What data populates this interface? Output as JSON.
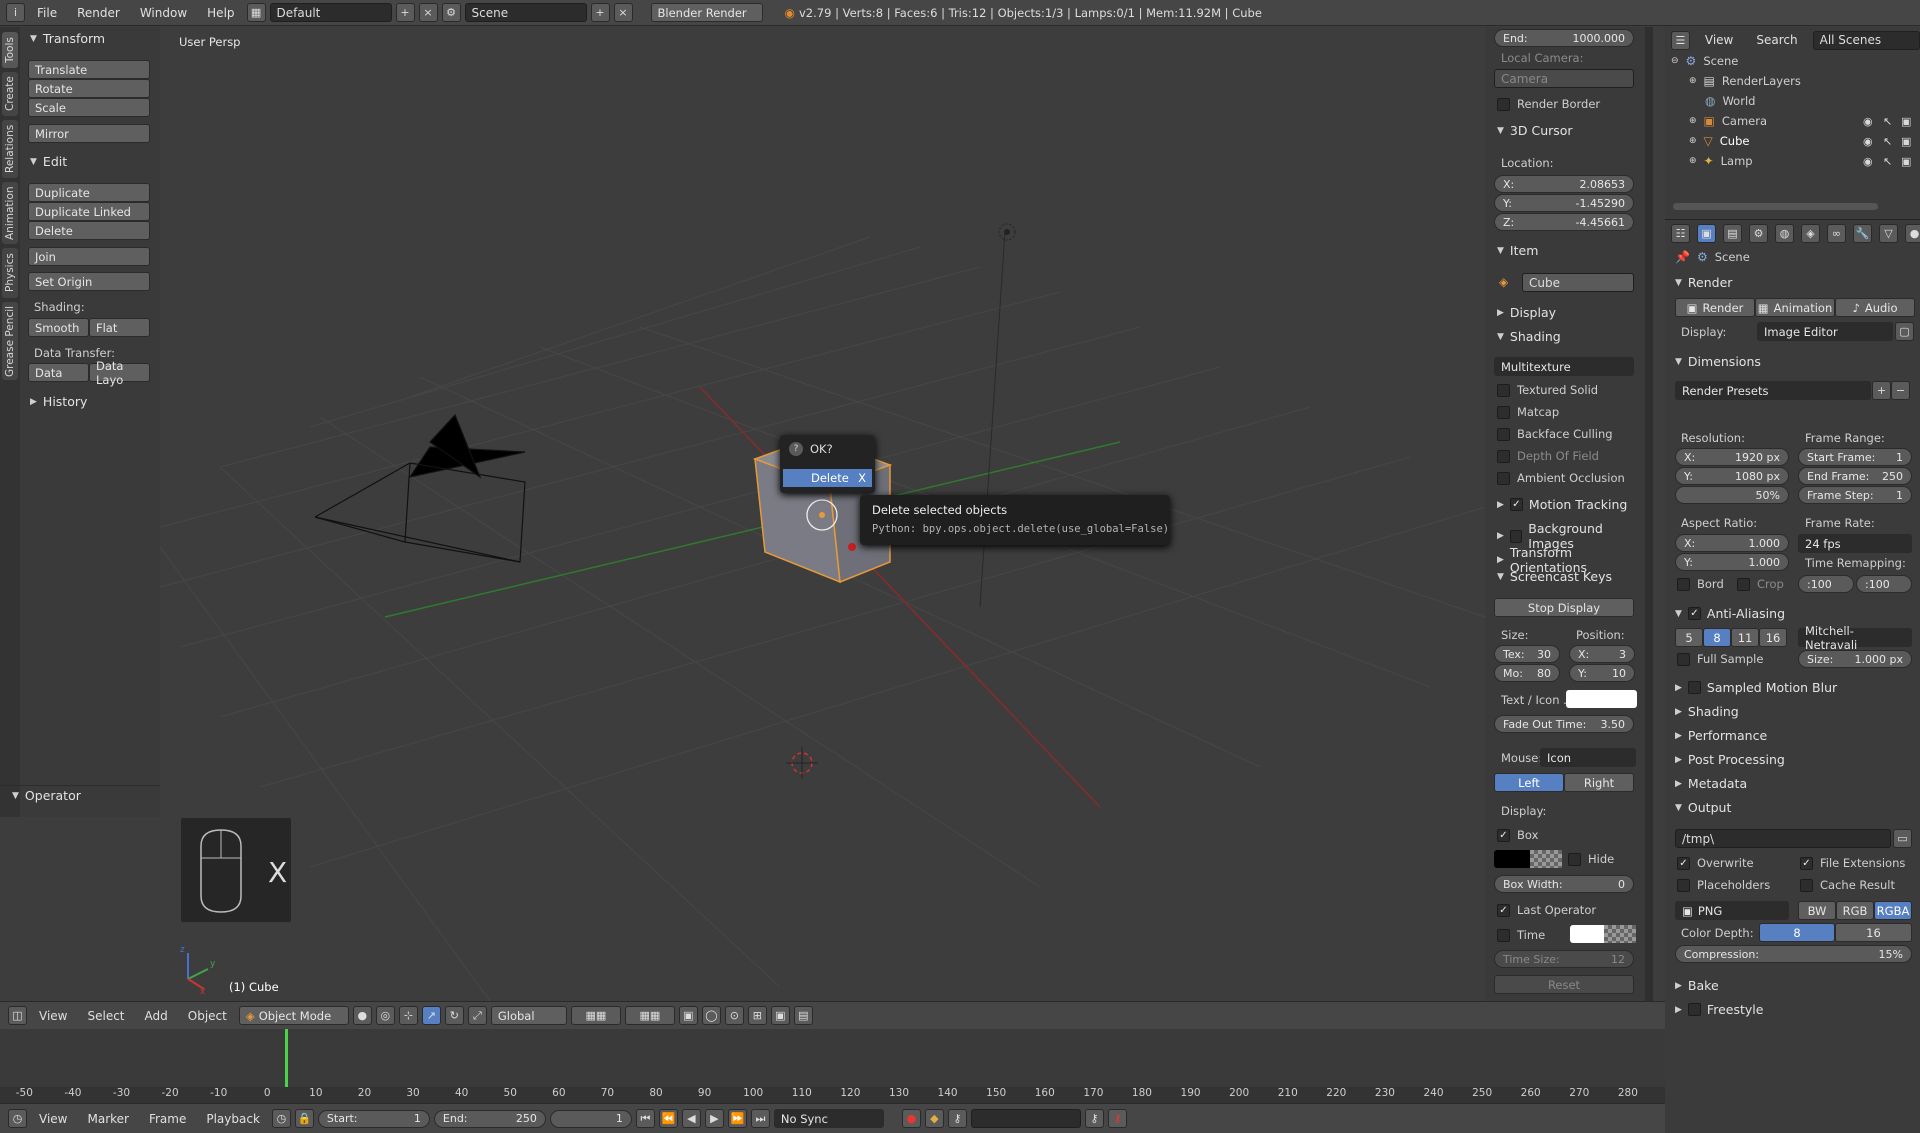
{
  "topbar": {
    "menus": [
      "File",
      "Render",
      "Window",
      "Help"
    ],
    "layout": "Default",
    "scene": "Scene",
    "engine": "Blender Render",
    "stats": "v2.79 | Verts:8 | Faces:6 | Tris:12 | Objects:1/3 | Lamps:0/1 | Mem:11.92M | Cube"
  },
  "tabs": [
    "Tools",
    "Create",
    "Relations",
    "Animation",
    "Physics",
    "Grease Pencil"
  ],
  "toolshelf": {
    "transform_title": "Transform",
    "translate": "Translate",
    "rotate": "Rotate",
    "scale": "Scale",
    "mirror": "Mirror",
    "edit_title": "Edit",
    "duplicate": "Duplicate",
    "duplicate_linked": "Duplicate Linked",
    "delete": "Delete",
    "join": "Join",
    "set_origin": "Set Origin",
    "shading_label": "Shading:",
    "smooth": "Smooth",
    "flat": "Flat",
    "data_transfer_label": "Data Transfer:",
    "data": "Data",
    "data_layo": "Data Layo",
    "history": "History",
    "operator": "Operator"
  },
  "viewport": {
    "label": "User Persp",
    "object_label": "(1) Cube",
    "key_x": "X",
    "axis_x": "x",
    "axis_y": "y",
    "axis_z": "z"
  },
  "popup": {
    "title": "OK?",
    "delete": "Delete",
    "shortcut": "X"
  },
  "tooltip": {
    "title": "Delete selected objects",
    "python": "Python: bpy.ops.object.delete(use_global=False)"
  },
  "properties": {
    "end_label": "End:",
    "end_value": "1000.000",
    "local_camera": "Local Camera:",
    "camera": "Camera",
    "render_border": "Render Border",
    "cursor_title": "3D Cursor",
    "location": "Location:",
    "x_label": "X:",
    "x": "2.08653",
    "y_label": "Y:",
    "y": "-1.45290",
    "z_label": "Z:",
    "z": "-4.45661",
    "item_title": "Item",
    "item_name": "Cube",
    "display_title": "Display",
    "shading_title": "Shading",
    "multitexture": "Multitexture",
    "textured_solid": "Textured Solid",
    "matcap": "Matcap",
    "backface": "Backface Culling",
    "dof": "Depth Of Field",
    "ao": "Ambient Occlusion",
    "motion_tracking": "Motion Tracking",
    "bg_images": "Background Images",
    "transform_orient": "Transform Orientations",
    "screencast": "Screencast Keys",
    "stop_display": "Stop Display",
    "size": "Size:",
    "position": "Position:",
    "tex": "Tex:",
    "tex_val": "30",
    "mo": "Mo:",
    "mo_val": "80",
    "pos_x": "X:",
    "pos_x_val": "3",
    "pos_y": "Y:",
    "pos_y_val": "10",
    "text_icon": "Text / Icon ...",
    "fade_out": "Fade Out Time:",
    "fade_val": "3.50",
    "mouse": "Mouse:",
    "mouse_val": "Icon",
    "left": "Left",
    "right": "Right",
    "display_label": "Display:",
    "box": "Box",
    "hide": "Hide",
    "box_width": "Box Width:",
    "box_width_val": "0",
    "last_operator": "Last Operator",
    "time": "Time",
    "time_size": "Time Size:",
    "time_size_val": "12",
    "reset": "Reset"
  },
  "outliner": {
    "view": "View",
    "search": "Search",
    "all_scenes": "All Scenes",
    "items": [
      "Scene",
      "RenderLayers",
      "World",
      "Camera",
      "Cube",
      "Lamp"
    ]
  },
  "render": {
    "scene": "Scene",
    "render_title": "Render",
    "render_btn": "Render",
    "animation_btn": "Animation",
    "audio_btn": "Audio",
    "display": "Display:",
    "display_val": "Image Editor",
    "dimensions": "Dimensions",
    "presets": "Render Presets",
    "resolution": "Resolution:",
    "res_x_label": "X:",
    "res_x": "1920 px",
    "res_y_label": "Y:",
    "res_y": "1080 px",
    "res_pct": "50%",
    "frame_range": "Frame Range:",
    "start_frame_label": "Start Frame:",
    "start_frame": "1",
    "end_frame_label": "End Frame:",
    "end_frame": "250",
    "frame_step_label": "Frame Step:",
    "frame_step": "1",
    "aspect": "Aspect Ratio:",
    "asp_x_label": "X:",
    "asp_x": "1.000",
    "asp_y_label": "Y:",
    "asp_y": "1.000",
    "frame_rate": "Frame Rate:",
    "fps": "24 fps",
    "time_remap": "Time Remapping:",
    "remap_old": ":100",
    "remap_new": ":100",
    "bord": "Bord",
    "crop": "Crop",
    "aa": "Anti-Aliasing",
    "aa_samples": [
      "5",
      "8",
      "11",
      "16"
    ],
    "filter": "Mitchell-Netravali",
    "full_sample": "Full Sample",
    "aa_size_label": "Size:",
    "aa_size": "1.000 px",
    "smb": "Sampled Motion Blur",
    "shading": "Shading",
    "performance": "Performance",
    "post": "Post Processing",
    "metadata": "Metadata",
    "output": "Output",
    "path": "/tmp\\",
    "overwrite": "Overwrite",
    "file_ext": "File Extensions",
    "placeholders": "Placeholders",
    "cache": "Cache Result",
    "format": "PNG",
    "bw": "BW",
    "rgb": "RGB",
    "rgba": "RGBA",
    "color_depth": "Color Depth:",
    "depth8": "8",
    "depth16": "16",
    "compression_label": "Compression:",
    "compression": "15%",
    "bake": "Bake",
    "freestyle": "Freestyle"
  },
  "viewheader": {
    "view": "View",
    "select": "Select",
    "add": "Add",
    "object": "Object",
    "mode": "Object Mode",
    "orientation": "Global"
  },
  "timeline": {
    "ticks": [
      "-50",
      "-40",
      "-30",
      "-20",
      "-10",
      "0",
      "10",
      "20",
      "30",
      "40",
      "50",
      "60",
      "70",
      "80",
      "90",
      "100",
      "110",
      "120",
      "130",
      "140",
      "150",
      "160",
      "170",
      "180",
      "190",
      "200",
      "210",
      "220",
      "230",
      "240",
      "250",
      "260",
      "270",
      "280"
    ],
    "view": "View",
    "marker": "Marker",
    "frame": "Frame",
    "playback": "Playback",
    "start_label": "Start:",
    "start": "1",
    "end_label": "End:",
    "end": "250",
    "current": "1",
    "sync": "No Sync"
  }
}
